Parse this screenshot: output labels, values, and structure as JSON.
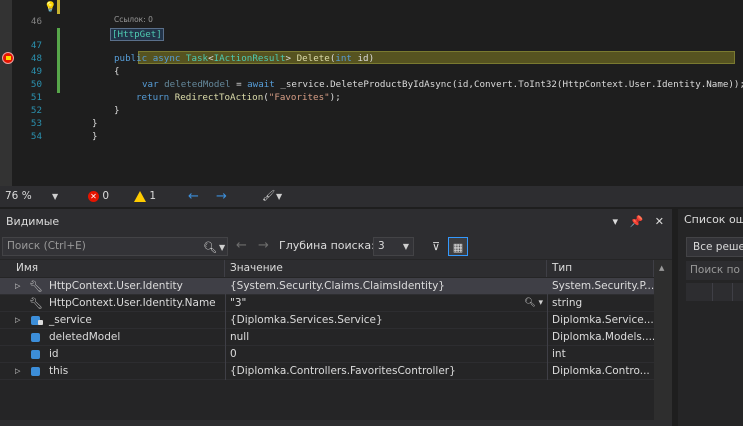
{
  "editor": {
    "lines": [
      {
        "num": "46",
        "code": "[HttpGet]"
      },
      {
        "num": "",
        "code": ""
      },
      {
        "num": "47",
        "code": "public async Task<IActionResult> Delete(int id)"
      },
      {
        "num": "48",
        "code": "{"
      },
      {
        "num": "49",
        "code": "var deletedModel = await _service.DeleteProductByIdAsync(id,Convert.ToInt32(HttpContext.User.Identity.Name));"
      },
      {
        "num": "50",
        "code": "return RedirectToAction(\"Favorites\");"
      },
      {
        "num": "51",
        "code": "}"
      },
      {
        "num": "52",
        "code": "}"
      },
      {
        "num": "53",
        "code": "}"
      },
      {
        "num": "54",
        "code": ""
      }
    ],
    "ref_count": "Ссылок: 0"
  },
  "status_bar": {
    "zoom": "76 %",
    "errors": "0",
    "warnings": "1"
  },
  "watch_panel": {
    "title": "Видимые",
    "search_placeholder": "Поиск (Ctrl+E)",
    "depth_label": "Глубина поиска:",
    "depth_value": "3",
    "columns": [
      "Имя",
      "Значение",
      "Тип"
    ],
    "rows": [
      {
        "name": "HttpContext.User.Identity",
        "value": "{System.Security.Claims.ClaimsIdentity}",
        "type": "System.Security.P...",
        "expandable": true,
        "icon": "wrench-icon"
      },
      {
        "name": "HttpContext.User.Identity.Name",
        "value": "\"3\"",
        "type": "string",
        "expandable": false,
        "icon": "wrench-icon"
      },
      {
        "name": "_service",
        "value": "{Diplomka.Services.Service}",
        "type": "Diplomka.Service...",
        "expandable": true,
        "icon": "private-field-icon"
      },
      {
        "name": "deletedModel",
        "value": "null",
        "type": "Diplomka.Models....",
        "expandable": false,
        "icon": "local-variable-icon"
      },
      {
        "name": "id",
        "value": "0",
        "type": "int",
        "expandable": false,
        "icon": "local-variable-icon"
      },
      {
        "name": "this",
        "value": "{Diplomka.Controllers.FavoritesController}",
        "type": "Diplomka.Contro...",
        "expandable": true,
        "icon": "local-variable-icon"
      }
    ]
  },
  "side_panel": {
    "title": "Список ош",
    "combo": "Все реше",
    "search": "Поиск по о",
    "header_k": "К"
  }
}
